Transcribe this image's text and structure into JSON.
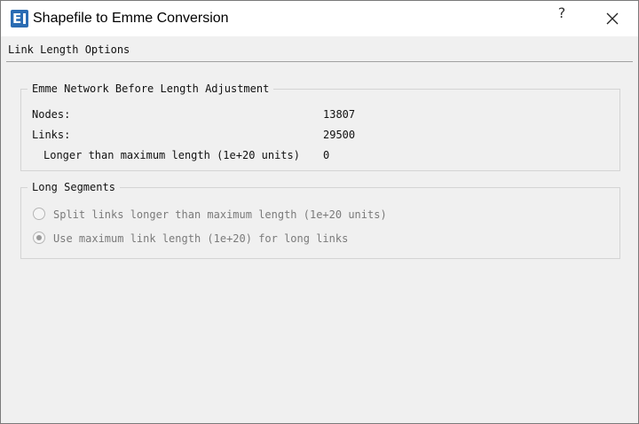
{
  "window": {
    "title": "Shapefile to Emme Conversion",
    "help_label": "?",
    "icon": "emme-app-icon"
  },
  "page": {
    "section_title": "Link Length Options"
  },
  "network_group": {
    "title": "Emme Network Before Length Adjustment",
    "rows": [
      {
        "label": "Nodes:",
        "value": "13807"
      },
      {
        "label": "Links:",
        "value": "29500"
      },
      {
        "label": "Longer than maximum length (1e+20 units)",
        "value": "0"
      }
    ]
  },
  "segments_group": {
    "title": "Long Segments",
    "options": [
      {
        "label": "Split links longer than maximum length (1e+20 units)",
        "checked": false,
        "enabled": false
      },
      {
        "label": "Use maximum link length (1e+20) for long links",
        "checked": true,
        "enabled": false
      }
    ]
  }
}
